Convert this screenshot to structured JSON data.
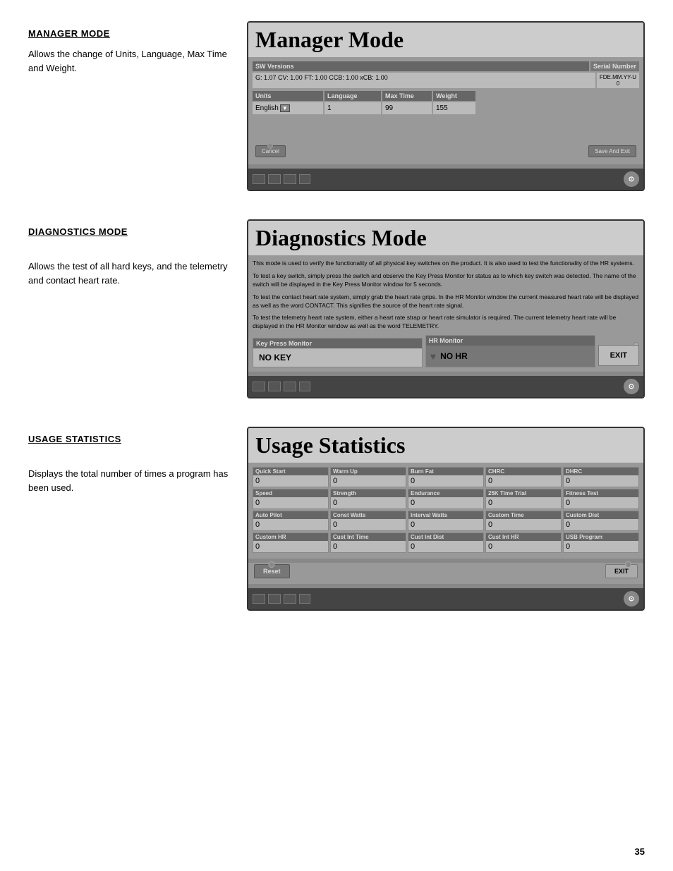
{
  "page": {
    "number": "35"
  },
  "manager_mode": {
    "section_title": "MANAGER MODE",
    "body_text": "Allows the change of Units, Language, Max Time and Weight.",
    "screen_title": "Manager Mode",
    "sw_versions_label": "SW Versions",
    "serial_number_label": "Serial Number",
    "sw_value": "G: 1.07  CV: 1.00  FT: 1.00  CCB: 1.00  xCB: 1.00",
    "serial_value": "FDE.MM.YY-U\n0",
    "units_label": "Units",
    "language_label": "Language",
    "max_time_label": "Max Time",
    "weight_label": "Weight",
    "units_value": "English",
    "language_value": "1",
    "max_time_value": "99",
    "weight_value": "155",
    "cancel_label": "Cancel",
    "save_label": "Save And Exit"
  },
  "diagnostics_mode": {
    "section_title": "DIAGNOSTICS MODE",
    "body_text": "Allows the test of all hard keys, and the telemetry and contact heart rate.",
    "screen_title": "Diagnostics Mode",
    "description_1": "This mode is used to verify the functionality of all physical key switches on the product. It is also used to test the functionality of the HR systems.",
    "description_2": "To test a key switch, simply press the switch and observe the Key Press Monitor for status as to which key switch was detected. The name of the switch will be displayed in the Key Press Monitor window for 5 seconds.",
    "description_3": "To test the contact heart rate system, simply grab the heart rate grips. In the HR Monitor window the current measured heart rate will be displayed as well as the word CONTACT. This signifies the source of the heart rate signal.",
    "description_4": "To test the telemetry heart rate system, either a heart rate strap or heart rate simulator is required. The current telemetry heart rate will be displayed in the HR Monitor window as well as the word TELEMETRY.",
    "key_press_label": "Key Press Monitor",
    "hr_label": "HR Monitor",
    "key_press_value": "NO KEY",
    "hr_value": "NO HR",
    "exit_label": "EXIT"
  },
  "usage_statistics": {
    "section_title": "USAGE STATISTICS",
    "body_text": "Displays the total number of times a program has been used.",
    "screen_title": "Usage Statistics",
    "stats": [
      {
        "label": "Quick Start",
        "value": "0"
      },
      {
        "label": "Warm Up",
        "value": "0"
      },
      {
        "label": "Burn Fat",
        "value": "0"
      },
      {
        "label": "CHRC",
        "value": "0"
      },
      {
        "label": "DHRC",
        "value": "0"
      },
      {
        "label": "Speed",
        "value": "0"
      },
      {
        "label": "Strength",
        "value": "0"
      },
      {
        "label": "Endurance",
        "value": "0"
      },
      {
        "label": "25K Time Trial",
        "value": "0"
      },
      {
        "label": "Fitness Test",
        "value": "0"
      },
      {
        "label": "Auto Pilot",
        "value": "0"
      },
      {
        "label": "Const Watts",
        "value": "0"
      },
      {
        "label": "Interval Watts",
        "value": "0"
      },
      {
        "label": "Custom Time",
        "value": "0"
      },
      {
        "label": "Custom Dist",
        "value": "0"
      },
      {
        "label": "Custom HR",
        "value": "0"
      },
      {
        "label": "Cust Int Time",
        "value": "0"
      },
      {
        "label": "Cust Int Dist",
        "value": "0"
      },
      {
        "label": "Cust Int HR",
        "value": "0"
      },
      {
        "label": "USB Program",
        "value": "0"
      }
    ],
    "reset_label": "Reset",
    "exit_label": "EXIT"
  }
}
